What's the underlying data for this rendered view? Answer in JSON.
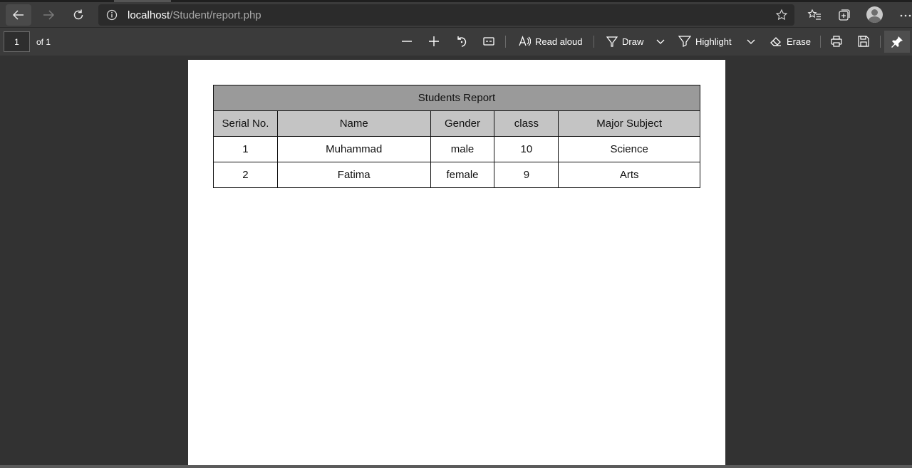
{
  "browser": {
    "url_host": "localhost",
    "url_path": "/Student/report.php"
  },
  "pdf_toolbar": {
    "page_number": "1",
    "page_of": "of 1",
    "read_aloud": "Read aloud",
    "draw": "Draw",
    "highlight": "Highlight",
    "erase": "Erase"
  },
  "report": {
    "title": "Students Report",
    "columns": [
      "Serial No.",
      "Name",
      "Gender",
      "class",
      "Major Subject"
    ],
    "rows": [
      [
        "1",
        "Muhammad",
        "male",
        "10",
        "Science"
      ],
      [
        "2",
        "Fatima",
        "female",
        "9",
        "Arts"
      ]
    ]
  }
}
